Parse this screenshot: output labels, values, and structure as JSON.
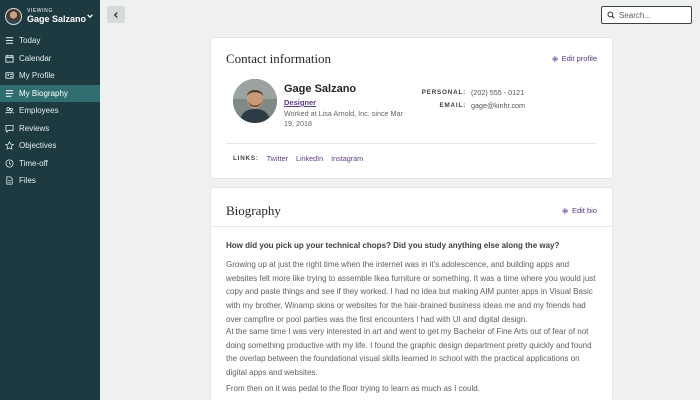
{
  "sidebar": {
    "viewing_label": "VIEWING",
    "user_name": "Gage Salzano",
    "items": [
      {
        "label": "Today",
        "icon": "list-icon",
        "active": false
      },
      {
        "label": "Calendar",
        "icon": "calendar-icon",
        "active": false
      },
      {
        "label": "My Profile",
        "icon": "profile-card-icon",
        "active": false
      },
      {
        "label": "My Biography",
        "icon": "list-icon",
        "active": true
      },
      {
        "label": "Employees",
        "icon": "people-icon",
        "active": false
      },
      {
        "label": "Reviews",
        "icon": "chat-icon",
        "active": false
      },
      {
        "label": "Objectives",
        "icon": "star-icon",
        "active": false
      },
      {
        "label": "Time-off",
        "icon": "clock-icon",
        "active": false
      },
      {
        "label": "Files",
        "icon": "file-icon",
        "active": false
      }
    ]
  },
  "topbar": {
    "search_placeholder": "Search..."
  },
  "contact": {
    "title": "Contact information",
    "edit_label": "Edit profile",
    "name": "Gage Salzano",
    "role": "Designer",
    "worked_at": "Worked at Lisa Arnold, Inc. since Mar 19, 2018",
    "personal_label": "PERSONAL:",
    "personal_value": "(202) 555 - 0121",
    "email_label": "EMAIL:",
    "email_value": "gage@kinhr.com",
    "links_label": "LINKS:",
    "links": [
      "Twitter",
      "LinkedIn",
      "Instagram"
    ]
  },
  "biography": {
    "title": "Biography",
    "edit_label": "Edit bio",
    "question": "How did you pick up your technical chops? Did you study anything else along the way?",
    "paragraphs": [
      "Growing up at just the right time when the internet was in it's adolescence, and building apps and websites felt more like trying to assemble Ikea furniture or something. It was a time where you would just copy and paste things and see if they worked. I had no idea but making AIM punter apps in Visual Basic with my brother, Winamp skins or websites for the hair-brained business ideas me and my friends had over campfire or pool parties was the first encounters I had with UI and digital design.",
      "At the same time I was very interested in art and went to get my Bachelor of Fine Arts out of fear of not doing something productive with my life. I found the graphic design department pretty quickly and found the overlap between the foundational visual skills learned in school with the practical applications on digital apps and websites.",
      "From then on it was pedal to the floor trying to learn as much as I could."
    ]
  },
  "colors": {
    "sidebar_bg": "#1c3a40",
    "sidebar_active": "#2f6d71",
    "link": "#5a3d8a",
    "page_bg": "#eef1ef"
  }
}
